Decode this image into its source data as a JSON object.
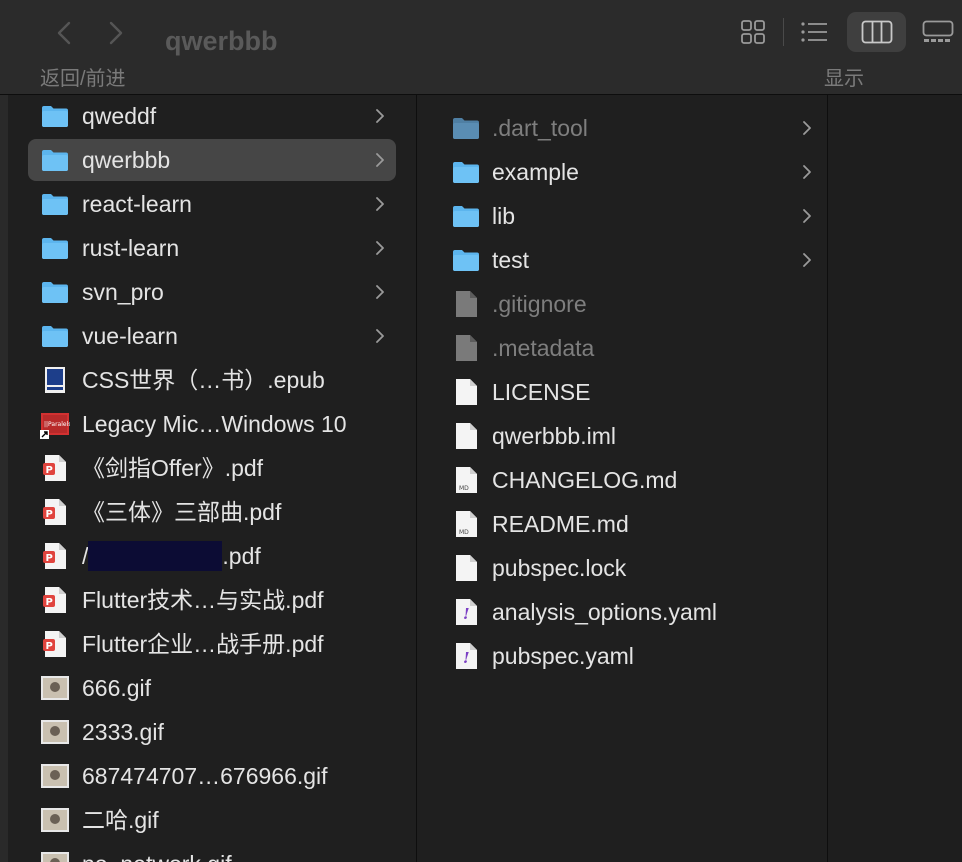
{
  "window": {
    "title": "qwerbbb"
  },
  "toolbar": {
    "nav_caption": "返回/前进",
    "view_caption": "显示"
  },
  "column1": {
    "items": [
      {
        "label": "qweddf",
        "type": "folder",
        "chevron": true
      },
      {
        "label": "qwerbbb",
        "type": "folder",
        "chevron": true,
        "selected": true
      },
      {
        "label": "react-learn",
        "type": "folder",
        "chevron": true
      },
      {
        "label": "rust-learn",
        "type": "folder",
        "chevron": true
      },
      {
        "label": "svn_pro",
        "type": "folder",
        "chevron": true
      },
      {
        "label": "vue-learn",
        "type": "folder",
        "chevron": true
      },
      {
        "label": "CSS世界（…书）.epub",
        "type": "epub-icon"
      },
      {
        "label": "Legacy Mic…Windows 10",
        "type": "parallels-alias-icon"
      },
      {
        "label": "《剑指Offer》.pdf",
        "type": "pdf-icon"
      },
      {
        "label": "《三体》三部曲.pdf",
        "type": "pdf-icon"
      },
      {
        "label": ".pdf",
        "prefix": "/",
        "type": "pdf-icon",
        "redacted": true
      },
      {
        "label": "Flutter技术…与实战.pdf",
        "type": "pdf-icon"
      },
      {
        "label": "Flutter企业…战手册.pdf",
        "type": "pdf-icon"
      },
      {
        "label": "666.gif",
        "type": "image-thumb-icon"
      },
      {
        "label": "2333.gif",
        "type": "image-thumb-icon"
      },
      {
        "label": "687474707…676966.gif",
        "type": "image-thumb-icon"
      },
      {
        "label": "二哈.gif",
        "type": "image-thumb-icon"
      },
      {
        "label": "no_network.gif",
        "type": "image-thumb-icon"
      }
    ]
  },
  "column2": {
    "items": [
      {
        "label": ".dart_tool",
        "type": "folder",
        "chevron": true,
        "dim": true
      },
      {
        "label": "example",
        "type": "folder",
        "chevron": true
      },
      {
        "label": "lib",
        "type": "folder",
        "chevron": true
      },
      {
        "label": "test",
        "type": "folder",
        "chevron": true
      },
      {
        "label": ".gitignore",
        "type": "document-icon",
        "dim": true
      },
      {
        "label": ".metadata",
        "type": "document-icon",
        "dim": true
      },
      {
        "label": "LICENSE",
        "type": "document-icon"
      },
      {
        "label": "qwerbbb.iml",
        "type": "document-icon"
      },
      {
        "label": "CHANGELOG.md",
        "type": "markdown-icon"
      },
      {
        "label": "README.md",
        "type": "markdown-icon"
      },
      {
        "label": "pubspec.lock",
        "type": "document-icon"
      },
      {
        "label": "analysis_options.yaml",
        "type": "yaml-icon"
      },
      {
        "label": "pubspec.yaml",
        "type": "yaml-icon"
      }
    ]
  },
  "colors": {
    "background": "#1f1f1f",
    "toolbar": "#2b2b2b",
    "selection": "#464646",
    "folder": "#5cb5ee",
    "text": "#e4e4e4",
    "dim_text": "#7e7e7e"
  }
}
